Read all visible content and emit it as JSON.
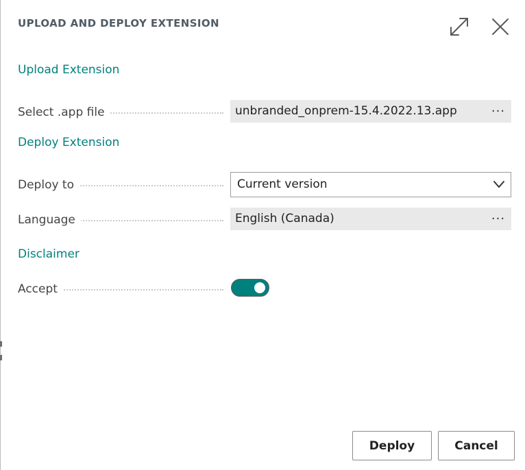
{
  "dialog": {
    "title": "UPLOAD AND DEPLOY EXTENSION",
    "expand_icon": "expand-icon",
    "close_icon": "close-icon"
  },
  "sections": {
    "upload": {
      "header": "Upload Extension",
      "select_app_label": "Select .app file",
      "select_app_value": "unbranded_onprem-15.4.2022.13.app",
      "lookup_label": "···"
    },
    "deploy": {
      "header": "Deploy Extension",
      "deploy_to_label": "Deploy to",
      "deploy_to_value": "Current version",
      "language_label": "Language",
      "language_value": "English (Canada)",
      "lookup_label": "···"
    },
    "disclaimer": {
      "header": "Disclaimer",
      "accept_label": "Accept",
      "accept_on": true
    }
  },
  "footer": {
    "deploy_label": "Deploy",
    "cancel_label": "Cancel"
  },
  "colors": {
    "accent": "#00817d",
    "title": "#505c66",
    "field_background": "#e9e9e9"
  }
}
